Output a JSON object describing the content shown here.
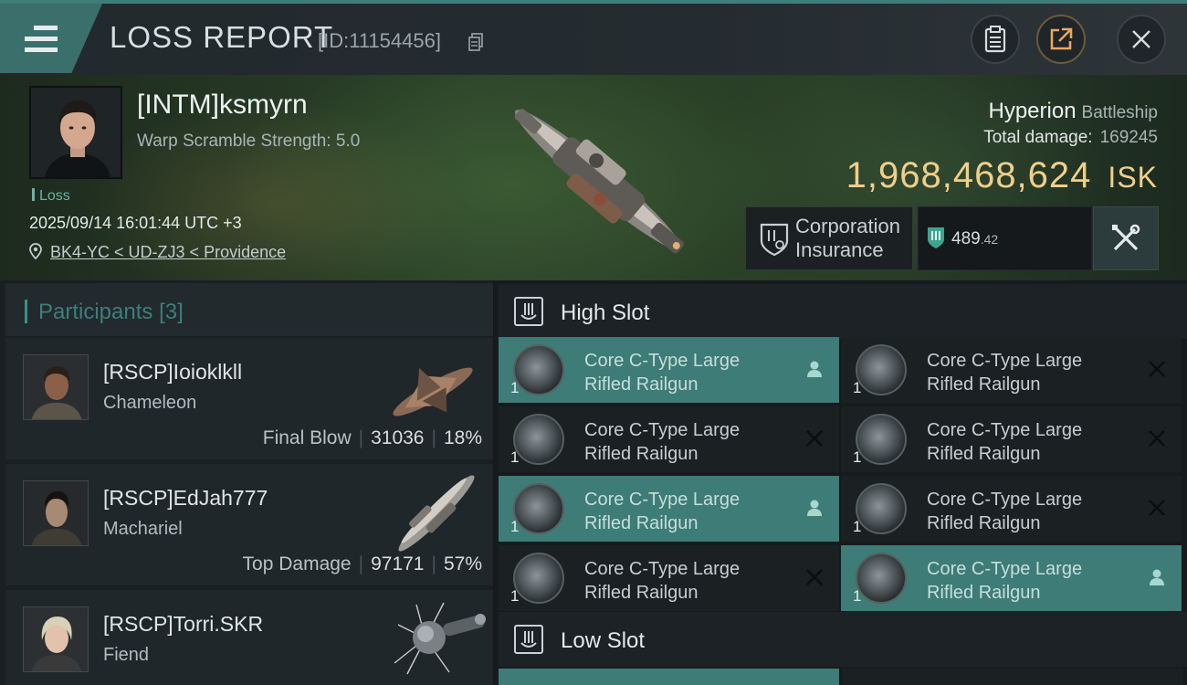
{
  "header": {
    "title": "LOSS REPORT",
    "report_id": "[ID:11154456]",
    "menu_icon": "hamburger-menu-icon",
    "buttons": [
      "clipboard-icon",
      "share-icon",
      "close-icon"
    ]
  },
  "victim": {
    "name": "[INTM]ksmyrn",
    "warp_scramble": "Warp Scramble Strength: 5.0",
    "status": "Loss",
    "datetime": "2025/09/14 16:01:44 UTC +3",
    "location": "BK4-YC < UD-ZJ3 < Providence",
    "ship": "Hyperion",
    "ship_class": "Battleship",
    "total_damage_label": "Total damage:",
    "total_damage": "169245",
    "isk_value": "1,968,468,624",
    "isk_unit": "ISK",
    "insurance_line1": "Corporation",
    "insurance_line2": "Insurance",
    "plex_main": "489",
    "plex_decimal": ".42"
  },
  "participants": {
    "title": "Participants",
    "count": "[3]",
    "list": [
      {
        "name": "[RSCP]Ioioklkll",
        "ship": "Chameleon",
        "role": "Final Blow",
        "damage": "31036",
        "percent": "18%"
      },
      {
        "name": "[RSCP]EdJah777",
        "ship": "Machariel",
        "role": "Top Damage",
        "damage": "97171",
        "percent": "57%"
      },
      {
        "name": "[RSCP]Torri.SKR",
        "ship": "Fiend"
      }
    ]
  },
  "slots": {
    "high": {
      "title": "High Slot",
      "modules": [
        {
          "line1": "Core C-Type Large",
          "line2": "Rifled Railgun",
          "qty": "1",
          "status": "fitted"
        },
        {
          "line1": "Core C-Type Large",
          "line2": "Rifled Railgun",
          "qty": "1",
          "status": "destroyed"
        },
        {
          "line1": "Core C-Type Large",
          "line2": "Rifled Railgun",
          "qty": "1",
          "status": "destroyed"
        },
        {
          "line1": "Core C-Type Large",
          "line2": "Rifled Railgun",
          "qty": "1",
          "status": "destroyed"
        },
        {
          "line1": "Core C-Type Large",
          "line2": "Rifled Railgun",
          "qty": "1",
          "status": "fitted"
        },
        {
          "line1": "Core C-Type Large",
          "line2": "Rifled Railgun",
          "qty": "1",
          "status": "destroyed"
        },
        {
          "line1": "Core C-Type Large",
          "line2": "Rifled Railgun",
          "qty": "1",
          "status": "destroyed"
        },
        {
          "line1": "Core C-Type Large",
          "line2": "Rifled Railgun",
          "qty": "1",
          "status": "fitted"
        }
      ]
    },
    "low": {
      "title": "Low Slot"
    }
  },
  "colors": {
    "accent": "#3d7c77",
    "isk": "#f0cf8a",
    "panel": "#20272b"
  }
}
